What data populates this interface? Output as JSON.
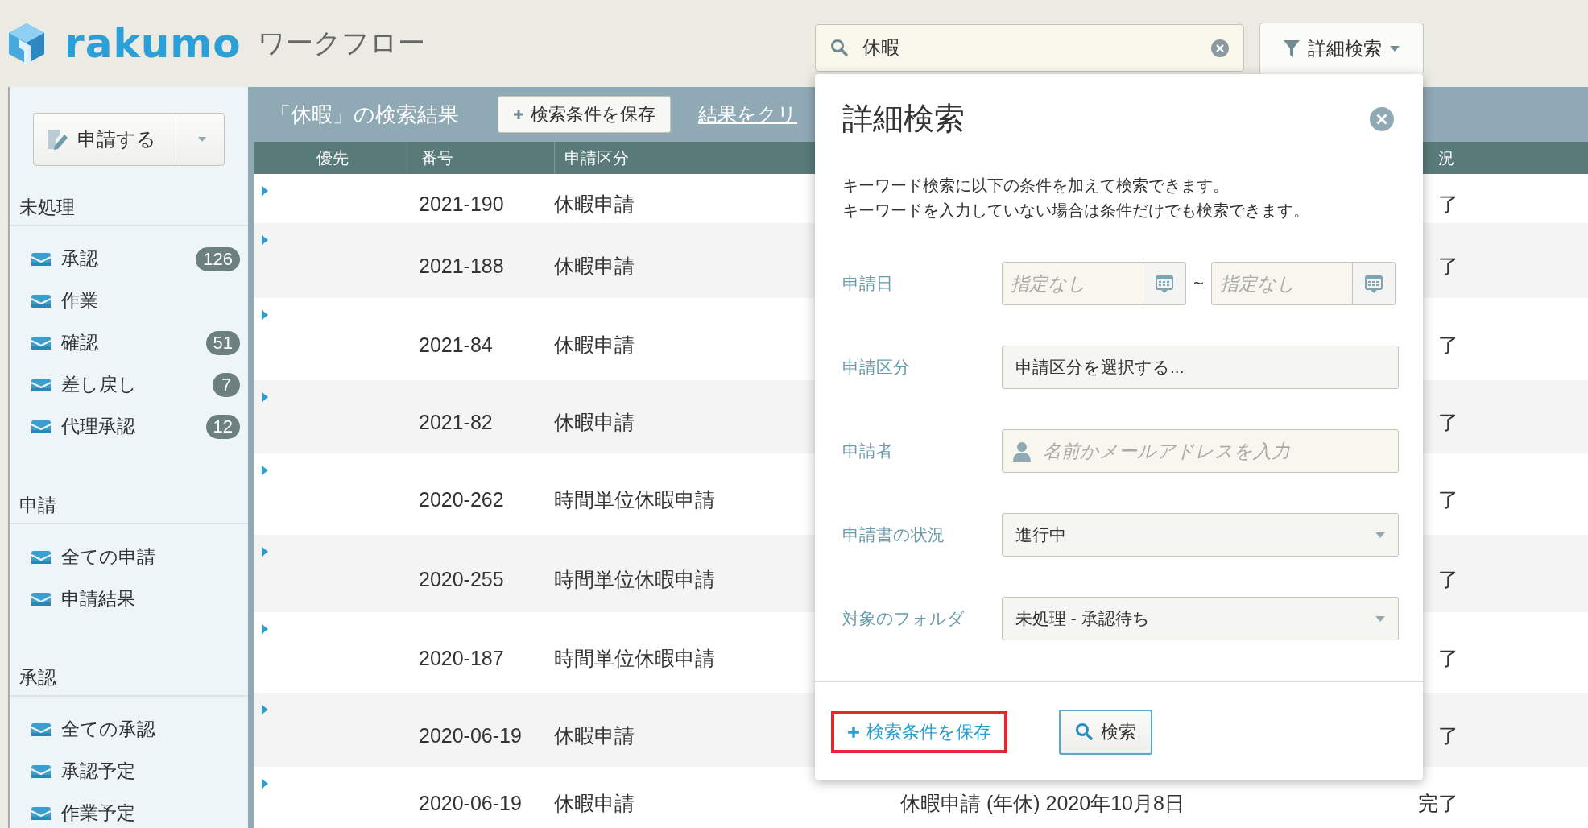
{
  "app": {
    "logo": "rakumo",
    "product": "ワークフロー"
  },
  "search": {
    "value": "休暇"
  },
  "advanced_search_button": {
    "label": "詳細検索",
    "expanded": true
  },
  "sidebar": {
    "new_button": "申請する",
    "sections": [
      {
        "title": "未処理",
        "items": [
          {
            "label": "承認",
            "count": "126"
          },
          {
            "label": "作業"
          },
          {
            "label": "確認",
            "count": "51"
          },
          {
            "label": "差し戻し",
            "count": "7"
          },
          {
            "label": "代理承認",
            "count": "12"
          }
        ]
      },
      {
        "title": "申請",
        "items": [
          {
            "label": "全ての申請"
          },
          {
            "label": "申請結果"
          }
        ]
      },
      {
        "title": "承認",
        "items": [
          {
            "label": "全ての承認"
          },
          {
            "label": "承認予定"
          },
          {
            "label": "作業予定"
          }
        ]
      }
    ]
  },
  "results": {
    "title": "「休暇」の検索結果",
    "save_button": "検索条件を保存",
    "clear_link": "結果をクリ",
    "columns": {
      "priority": "優先",
      "number": "番号",
      "type": "申請区分",
      "status": "況"
    },
    "rows": [
      {
        "number": "2021-190",
        "type": "休暇申請",
        "status": "了"
      },
      {
        "number": "2021-188",
        "type": "休暇申請",
        "status": "了"
      },
      {
        "number": "2021-84",
        "type": "休暇申請",
        "status": "了"
      },
      {
        "number": "2021-82",
        "type": "休暇申請",
        "status": "了"
      },
      {
        "number": "2020-262",
        "type": "時間単位休暇申請",
        "status": "了"
      },
      {
        "number": "2020-255",
        "type": "時間単位休暇申請",
        "status": "了"
      },
      {
        "number": "2020-187",
        "type": "時間単位休暇申請",
        "status": "了"
      },
      {
        "number": "2020-06-19",
        "type": "休暇申請",
        "status": "了"
      },
      {
        "number": "2020-06-19",
        "type": "休暇申請",
        "title": "休暇申請 (年休) 2020年10月8日",
        "status": "完了"
      }
    ]
  },
  "advanced_search": {
    "title": "詳細検索",
    "description": [
      "キーワード検索に以下の条件を加えて検索できます。",
      "キーワードを入力していない場合は条件だけでも検索できます。"
    ],
    "fields": [
      {
        "kind": "date_range",
        "label": "申請日",
        "from_placeholder": "指定なし",
        "separator": "~",
        "to_placeholder": "指定なし"
      },
      {
        "kind": "picker",
        "label": "申請区分",
        "value": "申請区分を選択する..."
      },
      {
        "kind": "person",
        "label": "申請者",
        "placeholder": "名前かメールアドレスを入力"
      },
      {
        "kind": "select",
        "label": "申請書の状況",
        "value": "進行中"
      },
      {
        "kind": "select",
        "label": "対象のフォルダ",
        "value": "未処理 - 承認待ち"
      }
    ],
    "save_button": {
      "label": "検索条件を保存",
      "highlighted": true
    },
    "search_button": "検索"
  }
}
